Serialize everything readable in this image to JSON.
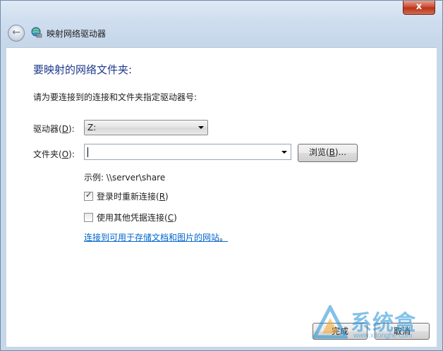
{
  "window": {
    "title": "映射网络驱动器",
    "close_glyph": "x"
  },
  "content": {
    "heading": "要映射的网络文件夹:",
    "instruction": "请为要连接到的连接和文件夹指定驱动器号:",
    "drive": {
      "label_prefix": "驱动器(",
      "label_key": "D",
      "label_suffix": "):",
      "selected": "Z:"
    },
    "folder": {
      "label_prefix": "文件夹(",
      "label_key": "O",
      "label_suffix": "):",
      "value": ""
    },
    "browse_label_prefix": "浏览(",
    "browse_label_key": "B",
    "browse_label_suffix": ")...",
    "example": "示例: \\\\server\\share",
    "reconnect": {
      "prefix": "登录时重新连接(",
      "key": "R",
      "suffix": ")",
      "checked": true
    },
    "other_credentials": {
      "prefix": "使用其他凭据连接(",
      "key": "C",
      "suffix": ")",
      "checked": false
    },
    "link": "连接到可用于存储文档和图片的网站",
    "link_tail": "。"
  },
  "buttons": {
    "finish": "完成",
    "cancel": "取消"
  },
  "watermark": {
    "text": "系统盒",
    "url": "www.xitonghe.com"
  },
  "colors": {
    "heading": "#1e3a8a",
    "link": "#0066cc",
    "close": "#c9452c"
  }
}
